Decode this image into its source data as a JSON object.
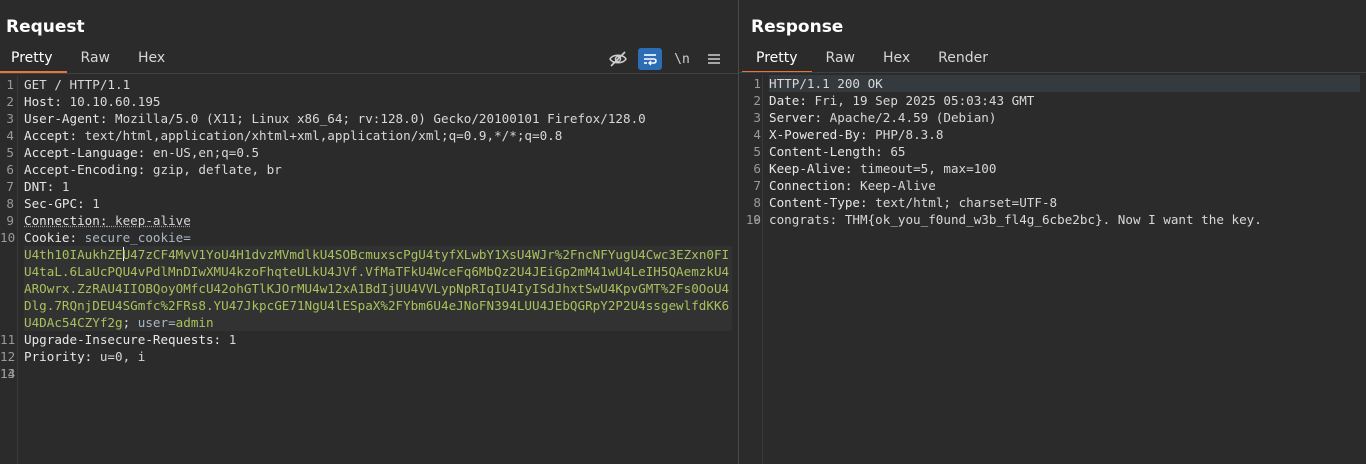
{
  "request": {
    "title": "Request",
    "tabs": [
      "Pretty",
      "Raw",
      "Hex"
    ],
    "active_tab": "Pretty",
    "toolbar": [
      "eye-slash-icon",
      "wrap-lines-icon",
      "newline-icon",
      "menu-icon"
    ],
    "newline_label": "\\n",
    "lines": [
      {
        "n": "1",
        "text": "GET / HTTP/1.1"
      },
      {
        "n": "2",
        "name": "Host:",
        "value": " 10.10.60.195"
      },
      {
        "n": "3",
        "name": "User-Agent:",
        "value": " Mozilla/5.0 (X11; Linux x86_64; rv:128.0) Gecko/20100101 Firefox/128.0"
      },
      {
        "n": "4",
        "name": "Accept:",
        "value": " text/html,application/xhtml+xml,application/xml;q=0.9,*/*;q=0.8"
      },
      {
        "n": "5",
        "name": "Accept-Language:",
        "value": " en-US,en;q=0.5"
      },
      {
        "n": "6",
        "name": "Accept-Encoding:",
        "value": " gzip, deflate, br"
      },
      {
        "n": "7",
        "name": "DNT:",
        "value": " 1"
      },
      {
        "n": "8",
        "name": "Sec-GPC:",
        "value": " 1"
      },
      {
        "n": "9",
        "name": "Connection:",
        "value": " keep-alive"
      },
      {
        "n": "10",
        "name": "Cookie:",
        "cookie_name": " secure_cookie=",
        "cookie_value_a": "U4th10IAukhZE",
        "cookie_value_b": "U47zCF4MvV1YoU4H1dvzMVmdlkU4SOBcmuxscPgU4tyfXLwbY1XsU4WJr%2FncNFYugU4Cwc3EZxn0FIU4taL.6LaUcPQU4vPdlMnDIwXMU4kzoFhqteULkU4JVf.VfMaTFkU4WceFq6MbQz2U4JEiGp2mM41wU4LeIH5QAemzkU4AROwrx.ZzRAU4IIOBQoyOMfcU42ohGTlKJOrMU4w12xA1BdIjUU4VVLypNpRIqIU4IyISdJhxtSwU4KpvGMT%2Fs0OoU4Dlg.7RQnjDEU4SGmfc%2FRs8.YU47JkpcGE71NgU4lESpaX%2FYbm6U4eJNoFN394LUU4JEbQGRpY2P2U4ssgewlfdKK6U4DAc54CZYf2g",
        "sep": "; ",
        "cookie2_name": "user=",
        "cookie2_value": "admin"
      },
      {
        "n": "11",
        "name": "Upgrade-Insecure-Requests:",
        "value": " 1"
      },
      {
        "n": "12",
        "name": "Priority:",
        "value": " u=0, i"
      },
      {
        "n": "13",
        "text": ""
      },
      {
        "n": "14",
        "text": ""
      }
    ]
  },
  "response": {
    "title": "Response",
    "tabs": [
      "Pretty",
      "Raw",
      "Hex",
      "Render"
    ],
    "active_tab": "Pretty",
    "lines": [
      {
        "n": "1",
        "text": "HTTP/1.1 200 OK"
      },
      {
        "n": "2",
        "name": "Date:",
        "value": " Fri, 19 Sep 2025 05:03:43 GMT"
      },
      {
        "n": "3",
        "name": "Server:",
        "value": " Apache/2.4.59 (Debian)"
      },
      {
        "n": "4",
        "name": "X-Powered-By:",
        "value": " PHP/8.3.8"
      },
      {
        "n": "5",
        "name": "Content-Length:",
        "value": " 65"
      },
      {
        "n": "6",
        "name": "Keep-Alive:",
        "value": " timeout=5, max=100"
      },
      {
        "n": "7",
        "name": "Connection:",
        "value": " Keep-Alive"
      },
      {
        "n": "8",
        "name": "Content-Type:",
        "value": " text/html; charset=UTF-8"
      },
      {
        "n": "9",
        "text": ""
      },
      {
        "n": "10",
        "text": "congrats: THM{ok_you_f0und_w3b_fl4g_6cbe2bc}. Now I want the key."
      }
    ]
  },
  "colors": {
    "background": "#2b2b2b",
    "active_tab_underline": "#e8743b",
    "wrap_button": "#2d6db5",
    "cookie_value": "#a8c15c"
  }
}
